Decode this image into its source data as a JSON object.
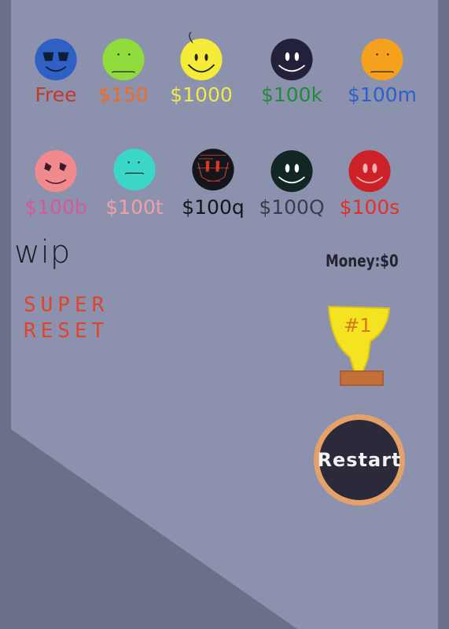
{
  "skins": [
    {
      "price": "Free",
      "price_color": "#c0392b",
      "face_color": "#2f60c4",
      "style": "sunglasses"
    },
    {
      "price": "$150",
      "price_color": "#f26b1d",
      "face_color": "#8fdc3c",
      "style": "neutral"
    },
    {
      "price": "$1000",
      "price_color": "#f2e94b",
      "face_color": "#f5ec3a",
      "style": "smile-hair"
    },
    {
      "price": "$100k",
      "price_color": "#218a3c",
      "face_color": "#23213a",
      "style": "smile-dark"
    },
    {
      "price": "$100m",
      "price_color": "#2d5fc9",
      "face_color": "#f6a11e",
      "style": "neutral"
    },
    {
      "price": "$100b",
      "price_color": "#d35a9a",
      "face_color": "#f08a8e",
      "style": "sparkle"
    },
    {
      "price": "$100t",
      "price_color": "#f0a0a8",
      "face_color": "#3bd8c9",
      "style": "neutral-small"
    },
    {
      "price": "$100q",
      "price_color": "#15151c",
      "face_color": "#15151c",
      "style": "glitch"
    },
    {
      "price": "$100Q",
      "price_color": "#3a3d4c",
      "face_color": "#122623",
      "style": "smile-dark"
    },
    {
      "price": "$100s",
      "price_color": "#e0302a",
      "face_color": "#cc2127",
      "style": "smile-red"
    }
  ],
  "wip_label": "wip",
  "super_reset": {
    "line1": "SUPER",
    "line2": "RESET"
  },
  "money": "Money:$0",
  "trophy_label": "#1",
  "restart_label": "Restart",
  "colors": {
    "panel": "#8c91ad",
    "background": "#6b7089",
    "trophy": "#f5e221",
    "trophy_base": "#c46f3a",
    "restart_ring": "#e6a16a",
    "restart_fill": "#2b2a3b"
  }
}
